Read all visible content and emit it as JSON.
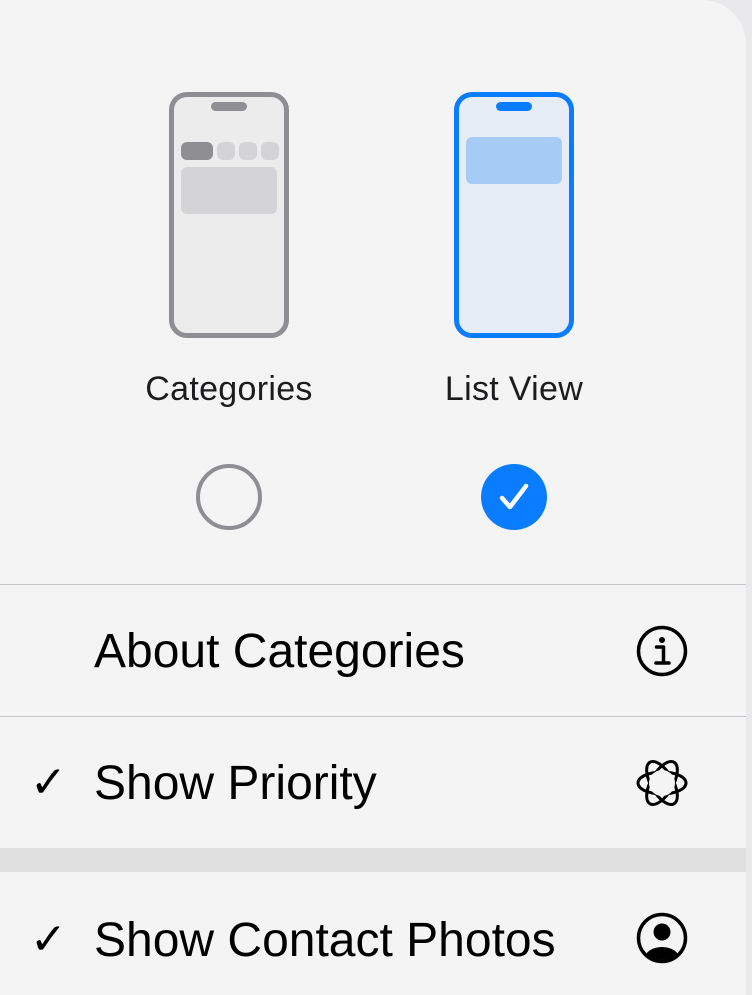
{
  "layout_options": [
    {
      "label": "Categories",
      "selected": false
    },
    {
      "label": "List View",
      "selected": true
    }
  ],
  "menu_items": [
    {
      "label": "About Categories",
      "checked": false,
      "icon": "info-circle-icon"
    },
    {
      "label": "Show Priority",
      "checked": true,
      "icon": "apple-intelligence-icon"
    },
    {
      "label": "Show Contact Photos",
      "checked": true,
      "icon": "person-circle-icon"
    }
  ],
  "check_glyph": "✓",
  "colors": {
    "accent": "#0a7cff",
    "unselected": "#8e8e93",
    "background": "#f4f4f4"
  }
}
